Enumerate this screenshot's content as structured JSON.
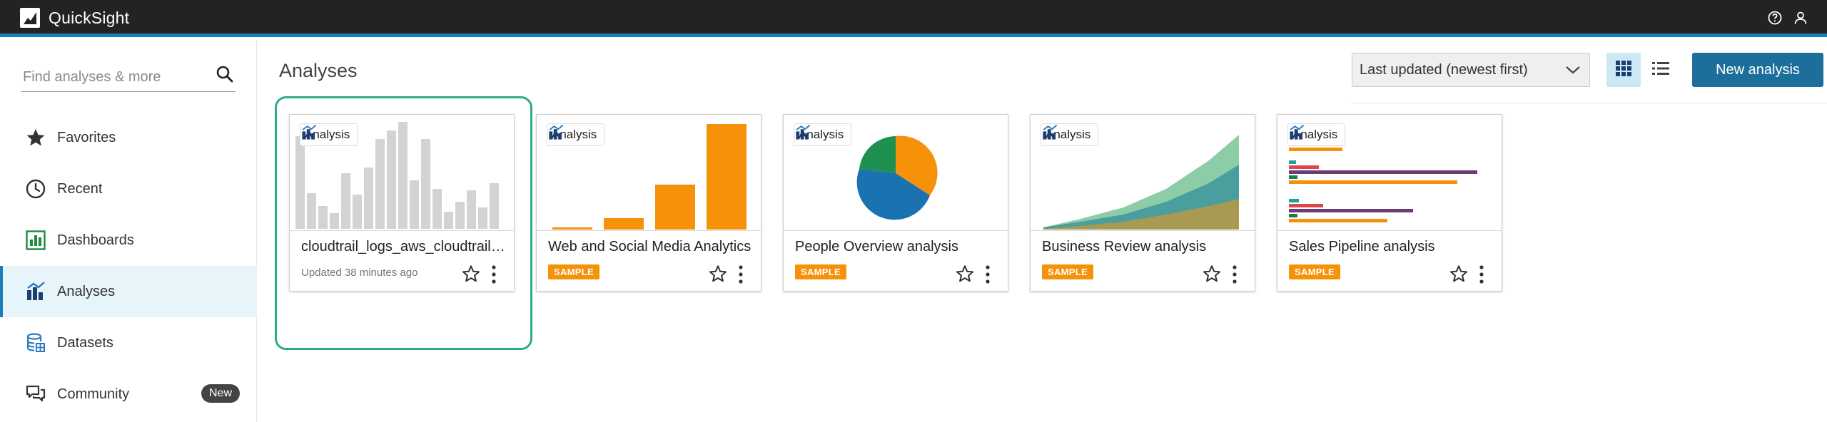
{
  "app": {
    "title": "QuickSight"
  },
  "search": {
    "placeholder": "Find analyses & more"
  },
  "sidebar": {
    "items": [
      {
        "label": "Favorites",
        "icon": "star-icon"
      },
      {
        "label": "Recent",
        "icon": "clock-icon"
      },
      {
        "label": "Dashboards",
        "icon": "dashboard-icon"
      },
      {
        "label": "Analyses",
        "icon": "analysis-icon",
        "active": true
      },
      {
        "label": "Datasets",
        "icon": "dataset-icon"
      },
      {
        "label": "Community",
        "icon": "community-icon",
        "badge": "New"
      }
    ]
  },
  "main": {
    "title": "Analyses",
    "sort_value": "Last updated (newest first)",
    "new_button": "New analysis"
  },
  "cards": [
    {
      "tag": "Analysis",
      "title": "cloudtrail_logs_aws_cloudtrail_logs",
      "subtitle": "Updated 38 minutes ago",
      "badge": "",
      "thumbnail": "bar-chart-gray"
    },
    {
      "tag": "Analysis",
      "title": "Web and Social Media Analytics",
      "subtitle": "",
      "badge": "SAMPLE",
      "thumbnail": "bar-chart-orange"
    },
    {
      "tag": "Analysis",
      "title": "People Overview analysis",
      "subtitle": "",
      "badge": "SAMPLE",
      "thumbnail": "pie-chart"
    },
    {
      "tag": "Analysis",
      "title": "Business Review analysis",
      "subtitle": "",
      "badge": "SAMPLE",
      "thumbnail": "area-chart"
    },
    {
      "tag": "Analysis",
      "title": "Sales Pipeline analysis",
      "subtitle": "",
      "badge": "SAMPLE",
      "thumbnail": "horizontal-bar-chart"
    }
  ],
  "colors": {
    "topbar": "#232323",
    "accent": "#1a7fb8",
    "primary_button": "#1b6f9a",
    "sample_badge": "#f6920a",
    "selected_frame": "#2eab8c"
  }
}
